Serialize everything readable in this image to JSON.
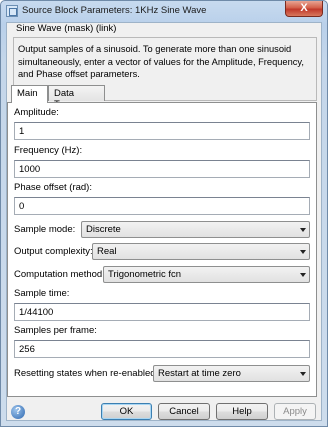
{
  "window": {
    "title": "Source Block Parameters: 1KHz Sine Wave",
    "close_glyph": "X"
  },
  "block": {
    "type_label": "Sine Wave (mask) (link)",
    "description": "Output samples of a sinusoid.  To generate more than one sinusoid simultaneously, enter a vector of values for the Amplitude, Frequency, and Phase offset parameters."
  },
  "tabs": [
    {
      "label": "Main",
      "active": true
    },
    {
      "label": "Data Types",
      "active": false
    }
  ],
  "params": {
    "amplitude": {
      "label": "Amplitude:",
      "value": "1"
    },
    "frequency": {
      "label": "Frequency (Hz):",
      "value": "1000"
    },
    "phase": {
      "label": "Phase offset (rad):",
      "value": "0"
    },
    "sample_mode": {
      "label": "Sample mode:",
      "value": "Discrete"
    },
    "output_complexity": {
      "label": "Output complexity:",
      "value": "Real"
    },
    "computation_method": {
      "label": "Computation method:",
      "value": "Trigonometric fcn"
    },
    "sample_time": {
      "label": "Sample time:",
      "value": "1/44100"
    },
    "samples_per_frame": {
      "label": "Samples per frame:",
      "value": "256"
    },
    "resetting_states": {
      "label": "Resetting states when re-enabled:",
      "value": "Restart at time zero"
    }
  },
  "buttons": {
    "help_icon": "?",
    "ok": "OK",
    "cancel": "Cancel",
    "help": "Help",
    "apply": "Apply"
  }
}
